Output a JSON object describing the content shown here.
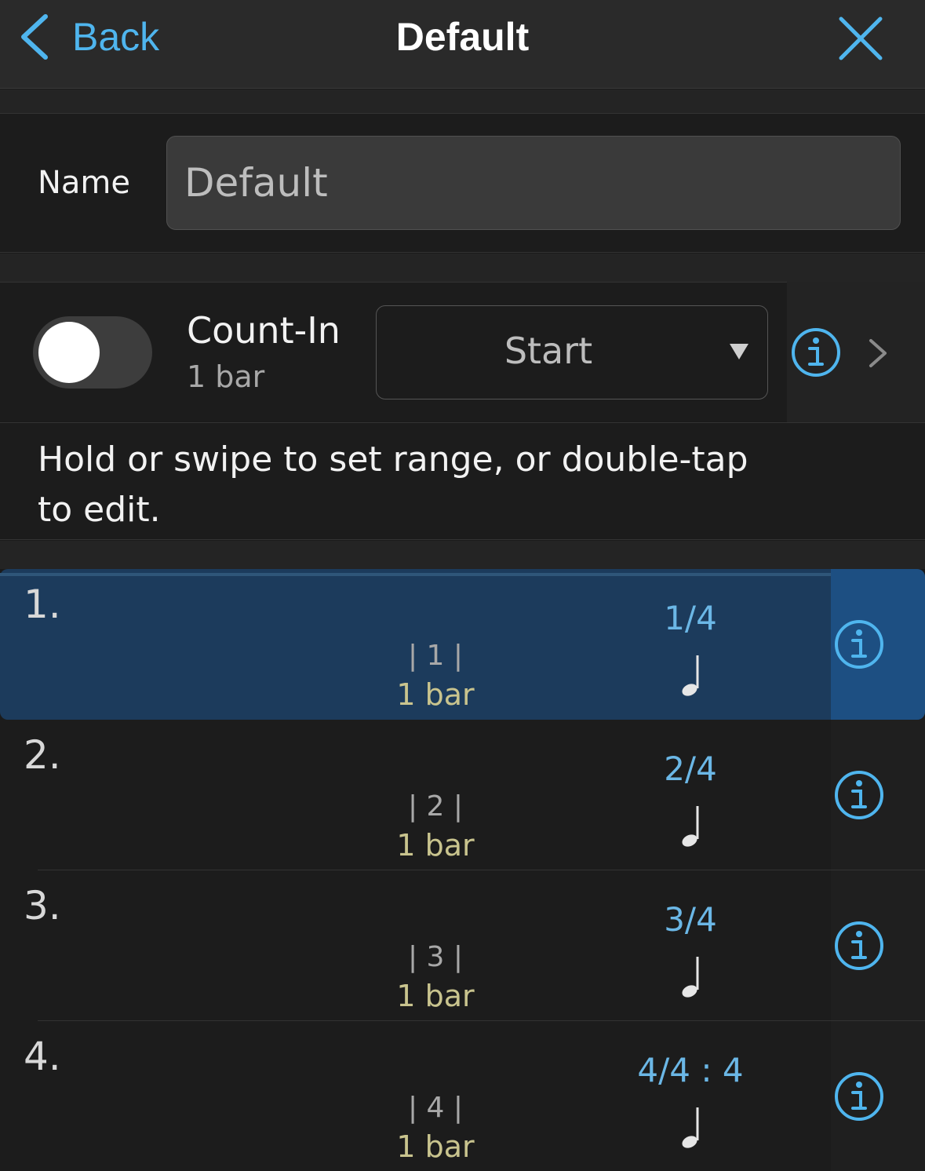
{
  "nav": {
    "back_label": "Back",
    "title": "Default",
    "back_icon": "chevron-left-icon",
    "close_icon": "close-icon"
  },
  "name_field": {
    "label": "Name",
    "value": "Default"
  },
  "count_in": {
    "title": "Count-In",
    "subtitle": "1 bar",
    "enabled": false,
    "select_value": "Start",
    "info_icon": "info-icon",
    "chevron_icon": "chevron-right-icon"
  },
  "hint": "Hold or swipe to set range, or double-tap to edit.",
  "bars": [
    {
      "index": "1.",
      "bar_label": "| 1 |",
      "length": "1 bar",
      "signature": "1/4",
      "note": "quarter-note-icon",
      "selected": true
    },
    {
      "index": "2.",
      "bar_label": "| 2 |",
      "length": "1 bar",
      "signature": "2/4",
      "note": "quarter-note-icon",
      "selected": false
    },
    {
      "index": "3.",
      "bar_label": "| 3 |",
      "length": "1 bar",
      "signature": "3/4",
      "note": "quarter-note-icon",
      "selected": false
    },
    {
      "index": "4.",
      "bar_label": "| 4 |",
      "length": "1 bar",
      "signature": "4/4 : 4",
      "note": "quarter-note-icon",
      "selected": false
    }
  ],
  "colors": {
    "accent": "#4fb5ee",
    "selected_row": "#1c3b5c",
    "selected_info_cell": "#1d4f82",
    "bar_length_text": "#c9c48e",
    "signature_text": "#6bb7e6"
  }
}
